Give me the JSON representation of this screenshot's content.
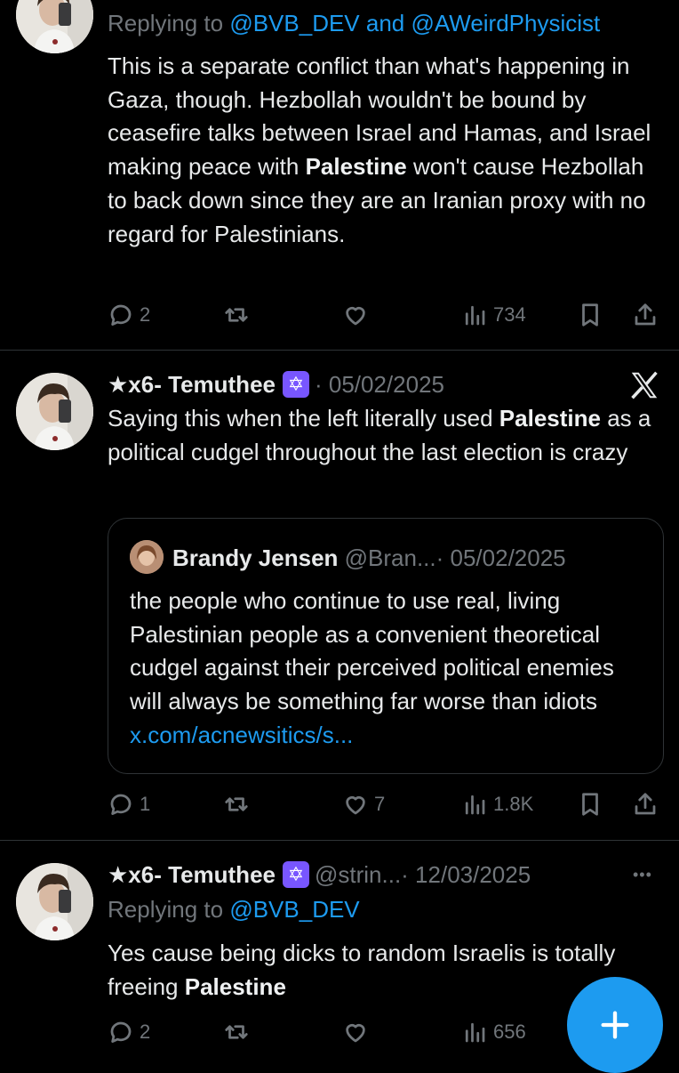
{
  "tweet1": {
    "reply_prefix": "Replying to ",
    "reply_to": "@BVB_DEV and @AWeirdPhysicist",
    "text_before": "This is a separate conflict than what's happening in Gaza, though. Hezbollah wouldn't be bound by ceasefire talks between Israel and Hamas, and Israel making peace with ",
    "bold_word": "Palestine",
    "text_after": " won't cause Hezbollah to back down since they are an Iranian proxy with no regard for Palestinians.",
    "replies": "2",
    "retweets": "",
    "likes": "",
    "views": "734"
  },
  "tweet2": {
    "name": "★x6- Temuthee",
    "badge": "✡",
    "date": "· 05/02/2025",
    "text_before": "Saying this when the left literally used ",
    "bold_word": "Palestine",
    "text_after": " as a political cudgel throughout the last election is crazy",
    "quote": {
      "name": "Brandy Jensen",
      "handle": "@Bran...",
      "date": "· 05/02/2025",
      "text": "the people who continue to use real, living Palestinian people as a convenient theoretical cudgel against their perceived political enemies will always be something far worse than idiots ",
      "link": "x.com/acnewsitics/s..."
    },
    "replies": "1",
    "likes": "7",
    "views": "1.8K"
  },
  "tweet3": {
    "name": "★x6- Temuthee",
    "badge": "✡",
    "handle": "@strin...",
    "date": "· 12/03/2025",
    "more": "•••",
    "reply_prefix": "Replying to ",
    "reply_to": "@BVB_DEV",
    "text_before": "Yes cause being dicks to random Israelis is totally freeing ",
    "bold_word": "Palestine",
    "replies": "2",
    "views": "656"
  },
  "colors": {
    "background": "#000000",
    "text": "#e7e9ea",
    "muted": "#71767b",
    "link": "#1d9bf0",
    "badge": "#7856ff",
    "fab": "#1d9bf0"
  },
  "icons": [
    "reply-icon",
    "retweet-icon",
    "like-icon",
    "views-icon",
    "bookmark-icon",
    "share-icon",
    "x-logo-icon",
    "compose-plus-icon",
    "more-icon"
  ]
}
